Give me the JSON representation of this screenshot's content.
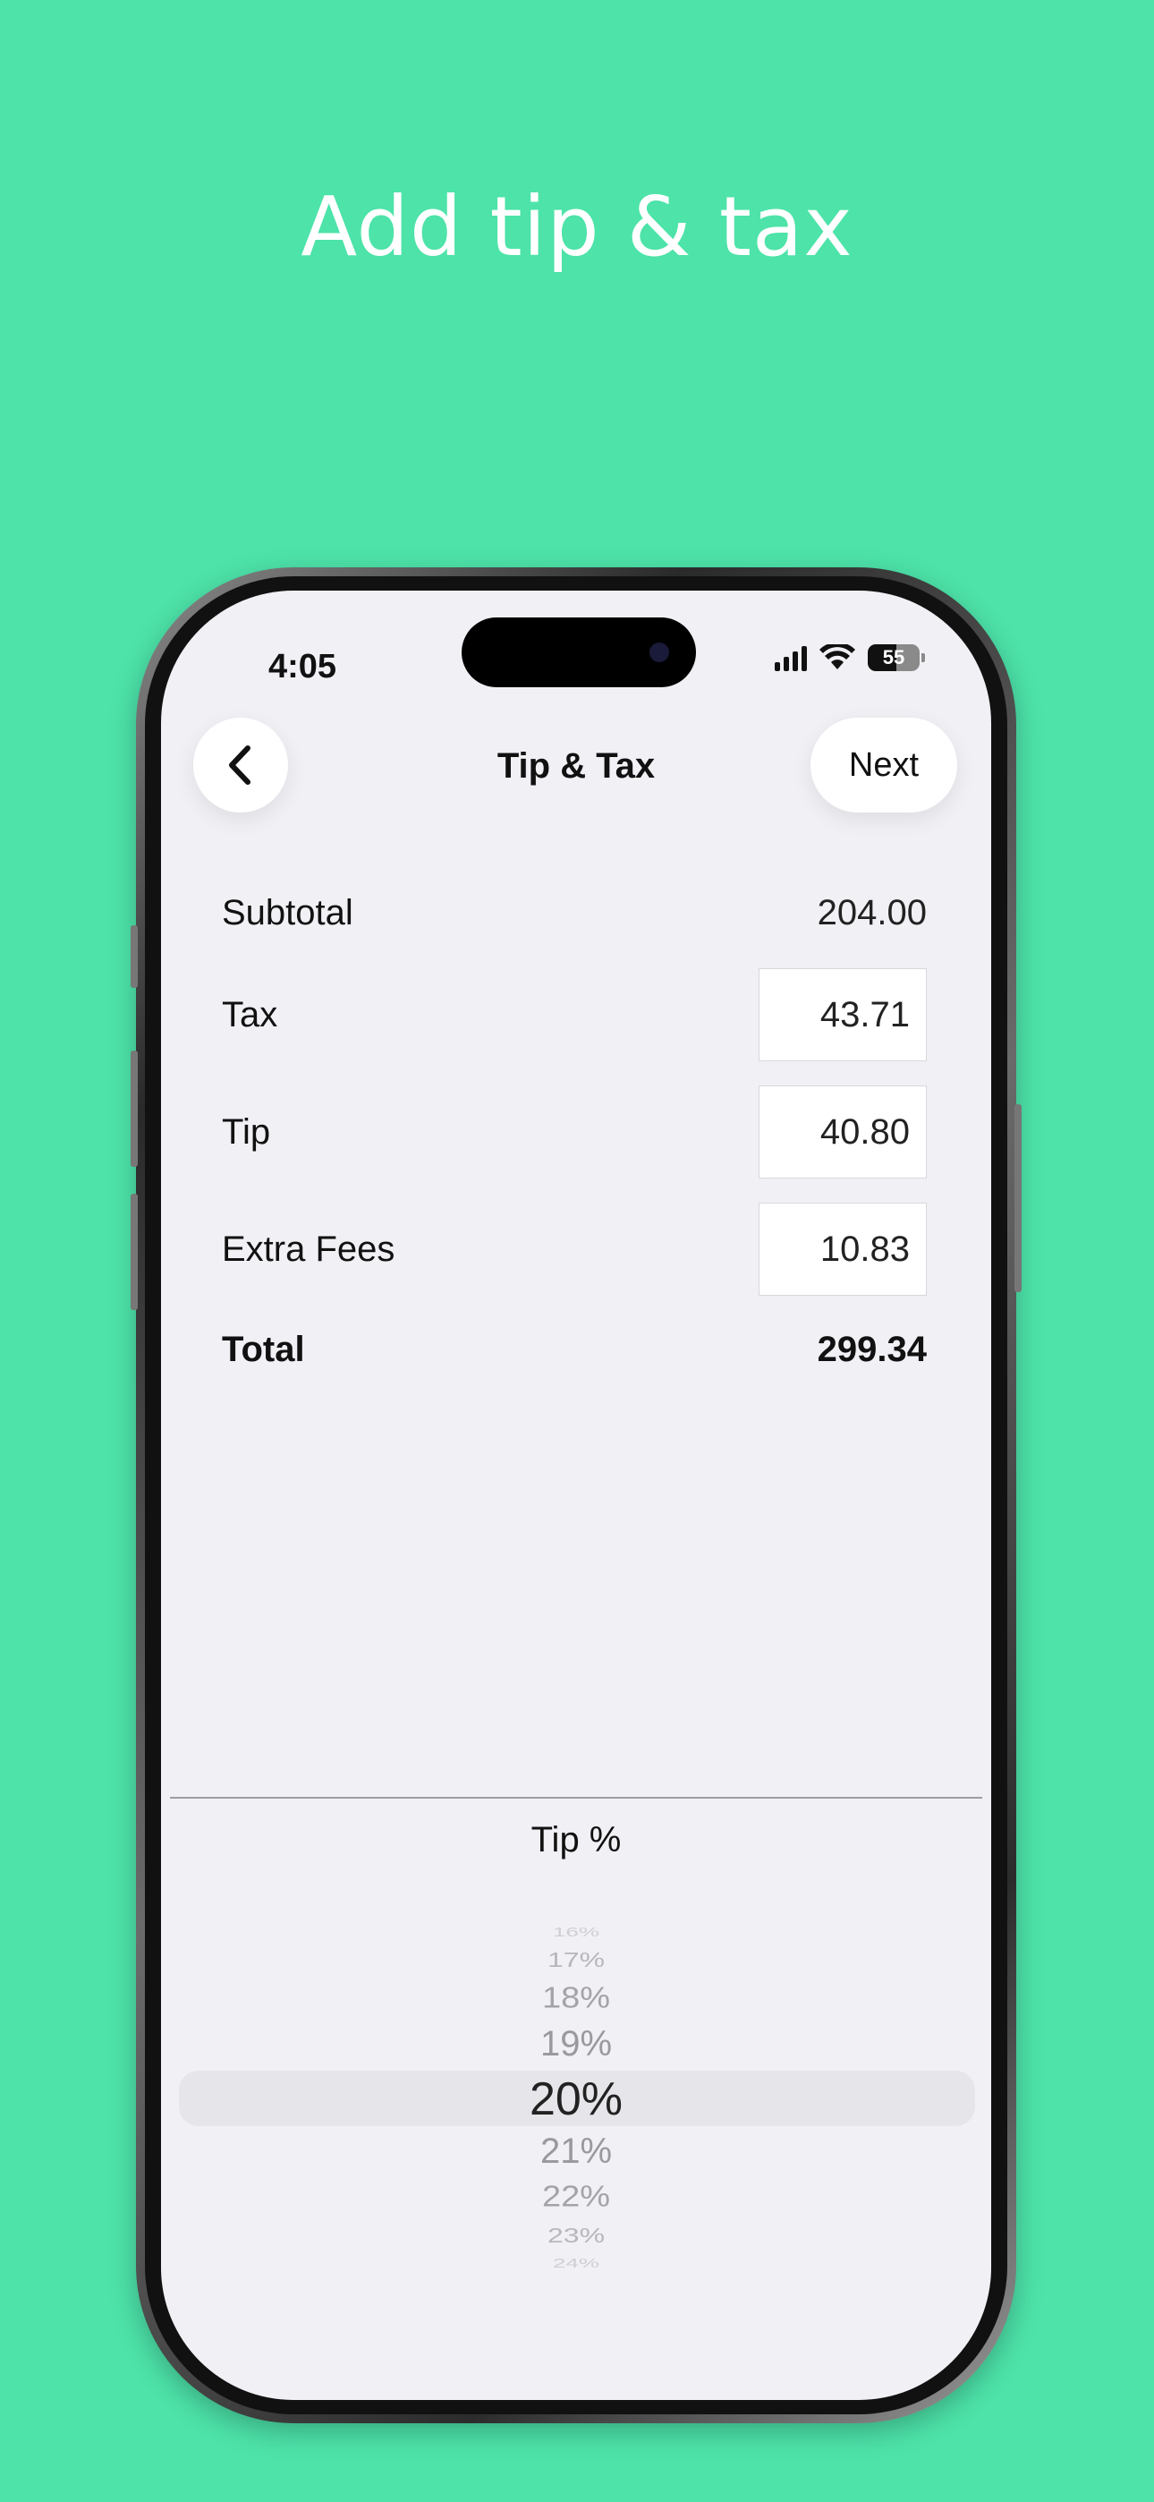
{
  "promo": {
    "headline": "Add tip & tax"
  },
  "status_bar": {
    "time": "4:05",
    "battery": "55",
    "icons": [
      "signal-icon",
      "wifi-icon",
      "battery-icon"
    ]
  },
  "nav": {
    "back_icon": "chevron-left-icon",
    "title": "Tip & Tax",
    "next_label": "Next"
  },
  "rows": {
    "subtotal": {
      "label": "Subtotal",
      "value": "204.00"
    },
    "tax": {
      "label": "Tax",
      "value": "43.71"
    },
    "tip": {
      "label": "Tip",
      "value": "40.80"
    },
    "extra_fees": {
      "label": "Extra Fees",
      "value": "10.83"
    },
    "total": {
      "label": "Total",
      "value": "299.34"
    }
  },
  "picker": {
    "title": "Tip %",
    "options": [
      "16%",
      "17%",
      "18%",
      "19%",
      "20%",
      "21%",
      "22%",
      "23%",
      "24%"
    ],
    "selected": "20%"
  },
  "colors": {
    "background": "#4de3a9",
    "screen": "#f1f0f5",
    "text": "#111111"
  }
}
